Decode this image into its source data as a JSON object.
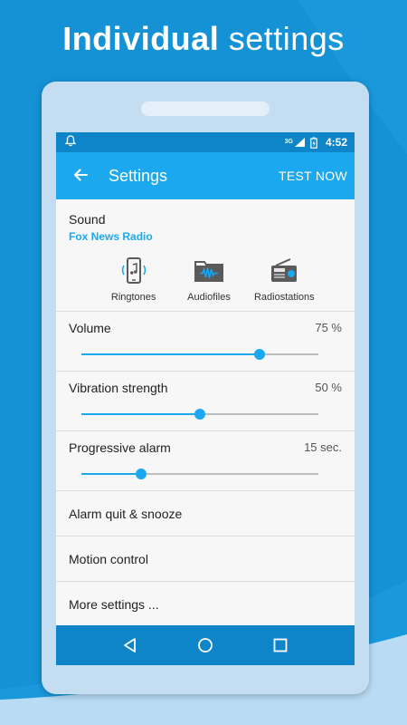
{
  "headline": {
    "bold": "Individual",
    "light": "settings"
  },
  "status_bar": {
    "network": "3G",
    "time": "4:52"
  },
  "app_bar": {
    "title": "Settings",
    "action": "TEST NOW"
  },
  "sound": {
    "label": "Sound",
    "station": "Fox News Radio",
    "sources": [
      {
        "label": "Ringtones",
        "icon": "phone-music-icon"
      },
      {
        "label": "Audiofiles",
        "icon": "audio-folder-icon"
      },
      {
        "label": "Radiostations",
        "icon": "radio-icon"
      }
    ]
  },
  "sliders": [
    {
      "label": "Volume",
      "value_text": "75  %",
      "fraction": 0.75
    },
    {
      "label": "Vibration strength",
      "value_text": "50  %",
      "fraction": 0.5
    },
    {
      "label": "Progressive alarm",
      "value_text": "15  sec.",
      "fraction": 0.25
    }
  ],
  "menu": [
    "Alarm quit & snooze",
    "Motion control",
    "More settings ..."
  ],
  "colors": {
    "accent": "#1ba8ee",
    "primary_dark": "#0e84c9",
    "background": "#1591d6"
  }
}
